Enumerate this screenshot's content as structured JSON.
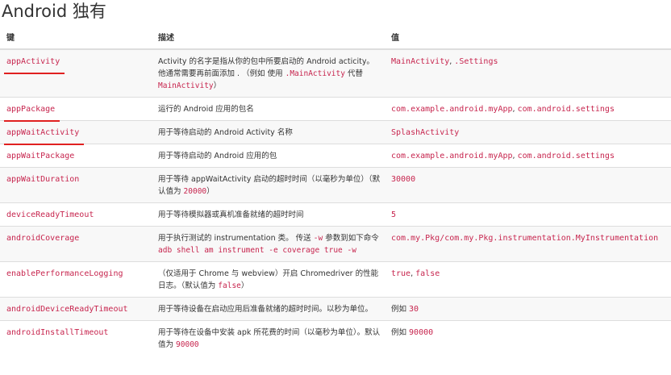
{
  "title": "Android 独有",
  "columns": {
    "key": "键",
    "desc": "描述",
    "value": "值"
  },
  "rows": [
    {
      "key": "appActivity",
      "desc_1": "Activity 的名字是指从你的包中所要启动的 Android acticity。他通常需要再前面添加 . （例如 使用 ",
      "desc_code_1": ".MainActivity",
      "desc_2": " 代替 ",
      "desc_code_2": "MainActivity",
      "desc_3": "）",
      "value": "MainActivity",
      "value_sep": ", ",
      "value_2": ".Settings"
    },
    {
      "key": "appPackage",
      "desc": "运行的 Android 应用的包名",
      "value": "com.example.android.myApp",
      "value_sep": ", ",
      "value_2": "com.android.settings"
    },
    {
      "key": "appWaitActivity",
      "desc": "用于等待启动的 Android Activity 名称",
      "value": "SplashActivity"
    },
    {
      "key": "appWaitPackage",
      "desc": "用于等待启动的 Android 应用的包",
      "value": "com.example.android.myApp",
      "value_sep": ", ",
      "value_2": "com.android.settings"
    },
    {
      "key": "appWaitDuration",
      "desc_1": "用于等待 appWaitActivity 启动的超时时间（以毫秒为单位）（默认值为 ",
      "desc_code_1": "20000",
      "desc_2": "）",
      "value": "30000"
    },
    {
      "key": "deviceReadyTimeout",
      "desc": "用于等待模拟器或真机准备就绪的超时时间",
      "value": "5"
    },
    {
      "key": "androidCoverage",
      "desc_1": "用于执行测试的 instrumentation 类。 传送 ",
      "desc_code_1": "-w",
      "desc_2": " 参数到如下命令 ",
      "desc_code_2": "adb shell am instrument -e coverage true -w",
      "value": "com.my.Pkg/com.my.Pkg.instrumentation.MyInstrumentation"
    },
    {
      "key": "enablePerformanceLogging",
      "desc_1": "（仅适用于 Chrome 与 webview）开启 Chromedriver 的性能日志。（默认值为 ",
      "desc_code_1": "false",
      "desc_2": "）",
      "value": "true",
      "value_sep": ", ",
      "value_2": "false"
    },
    {
      "key": "androidDeviceReadyTimeout",
      "desc": "用于等待设备在启动应用后准备就绪的超时时间。以秒为单位。",
      "value_prefix": "例如 ",
      "value": "30"
    },
    {
      "key": "androidInstallTimeout",
      "desc_1": "用于等待在设备中安装 apk 所花费的时间（以毫秒为单位）。默认值为 ",
      "desc_code_1": "90000",
      "value_prefix": "例如 ",
      "value": "90000"
    }
  ],
  "colors": {
    "code": "#c7254e",
    "underline": "#e02020",
    "border": "#dddddd"
  }
}
